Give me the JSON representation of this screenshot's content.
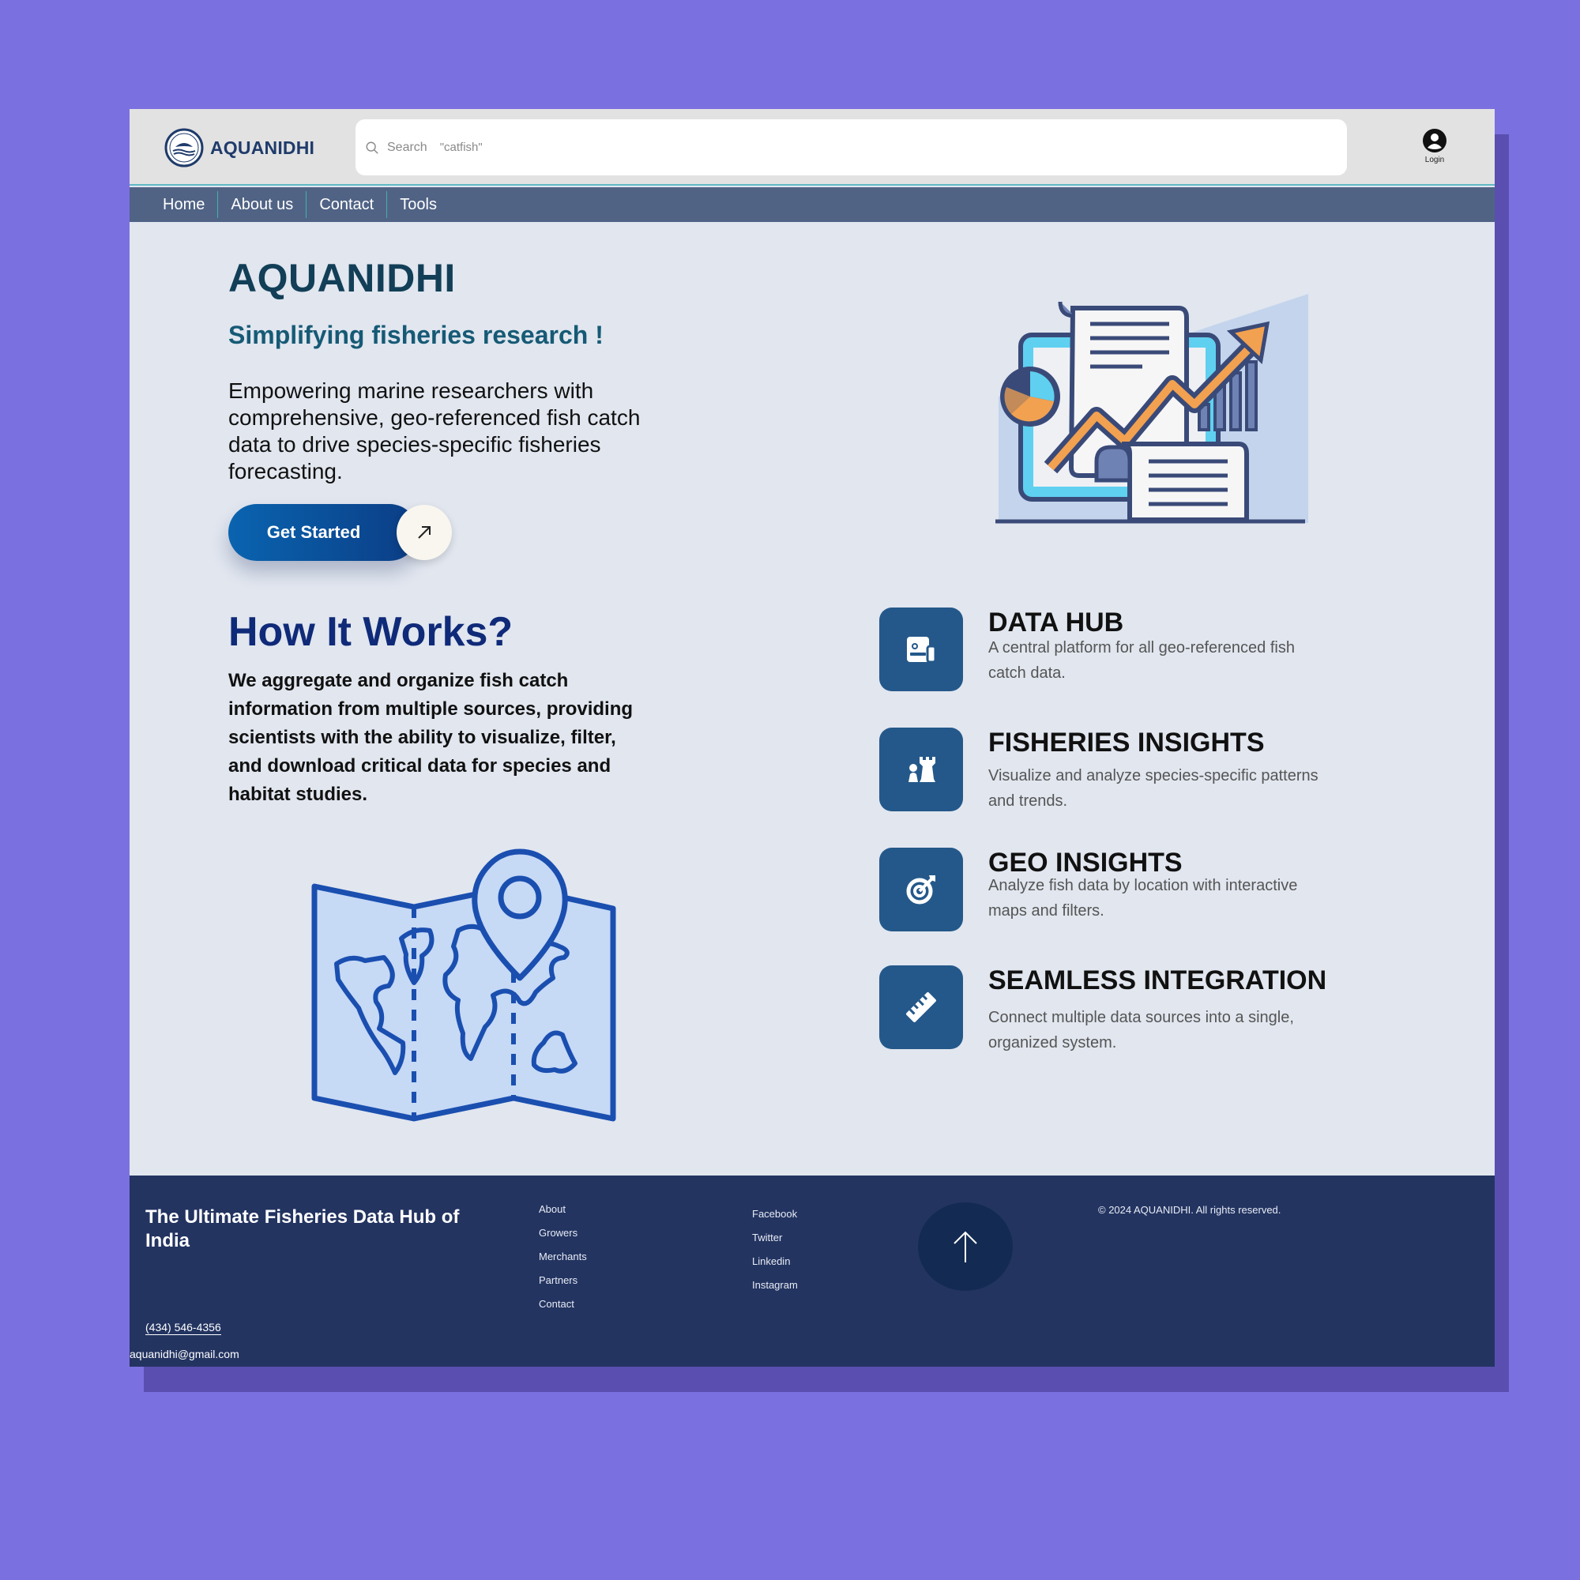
{
  "app": {
    "name": "AQUANIDHI"
  },
  "search": {
    "label": "Search",
    "placeholder": "\"catfish\""
  },
  "account": {
    "login_label": "Login"
  },
  "nav": {
    "items": [
      "Home",
      "About us",
      "Contact",
      "Tools"
    ]
  },
  "hero": {
    "title": "AQUANIDHI",
    "subtitle": "Simplifying fisheries research !",
    "description": "Empowering marine researchers with comprehensive, geo-referenced fish catch data to drive species-specific fisheries forecasting.",
    "cta_label": "Get Started",
    "cta_icon": "arrow-up-right-icon"
  },
  "how": {
    "title": "How It Works?",
    "description": "We aggregate and organize fish catch information from multiple sources, providing scientists with the ability to visualize, filter, and download critical data for species and habitat studies."
  },
  "features": [
    {
      "title": "DATA HUB",
      "description": "A central platform for all geo-referenced fish catch data.",
      "icon": "id-card-icon"
    },
    {
      "title": "FISHERIES INSIGHTS",
      "description": "Visualize and analyze species-specific patterns and trends.",
      "icon": "chess-pieces-icon"
    },
    {
      "title": "GEO INSIGHTS",
      "description": "Analyze fish data by location with interactive maps and filters.",
      "icon": "target-icon"
    },
    {
      "title": "SEAMLESS INTEGRATION",
      "description": "Connect multiple data sources into a single, organized system.",
      "icon": "ruler-icon"
    }
  ],
  "footer": {
    "tagline": "The Ultimate Fisheries Data Hub of India",
    "links": [
      "About",
      "Growers",
      "Merchants",
      "Partners",
      "Contact"
    ],
    "social": [
      "Facebook",
      "Twitter",
      "Linkedin",
      "Instagram"
    ],
    "copyright": "© 2024 AQUANIDHI. All rights reserved.",
    "phone": "(434) 546-4356",
    "email": "aquanidhi@gmail.com"
  },
  "colors": {
    "page_background": "#7b70e0",
    "content_background": "#e1e6ef",
    "nav_background": "#506385",
    "footer_background": "#233461",
    "accent": "#24588a",
    "heading": "#0f2a78"
  }
}
